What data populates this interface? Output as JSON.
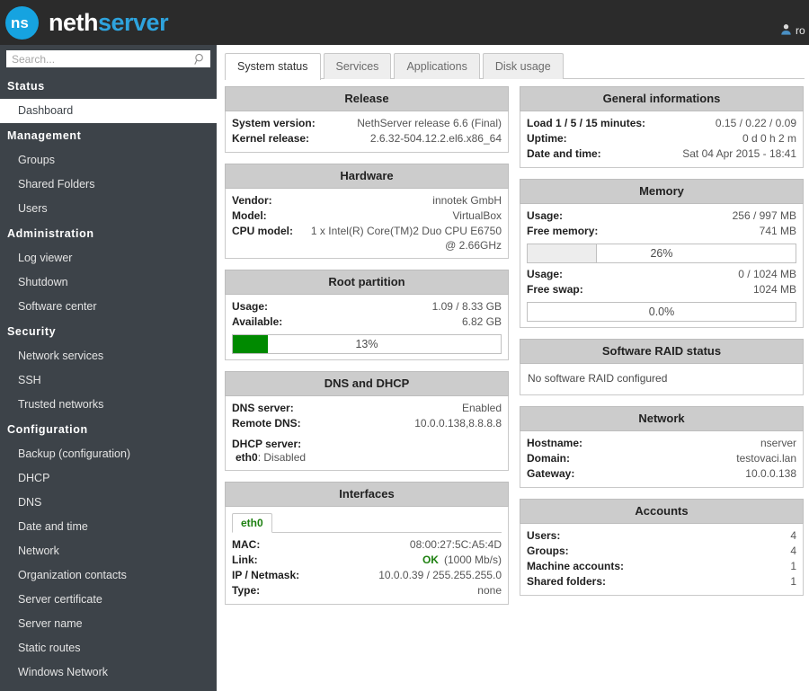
{
  "topbar": {
    "logo_mark": "ns-logo-icon",
    "brand_first": "neth",
    "brand_second": "server",
    "user_icon": "user-icon",
    "user_label": "ro"
  },
  "sidebar": {
    "search": {
      "placeholder": "Search...",
      "value": "",
      "icon": "search-icon"
    },
    "groups": [
      {
        "title": "Status",
        "items": [
          {
            "label": "Dashboard",
            "active": true
          }
        ]
      },
      {
        "title": "Management",
        "items": [
          {
            "label": "Groups",
            "active": false
          },
          {
            "label": "Shared Folders",
            "active": false
          },
          {
            "label": "Users",
            "active": false
          }
        ]
      },
      {
        "title": "Administration",
        "items": [
          {
            "label": "Log viewer",
            "active": false
          },
          {
            "label": "Shutdown",
            "active": false
          },
          {
            "label": "Software center",
            "active": false
          }
        ]
      },
      {
        "title": "Security",
        "items": [
          {
            "label": "Network services",
            "active": false
          },
          {
            "label": "SSH",
            "active": false
          },
          {
            "label": "Trusted networks",
            "active": false
          }
        ]
      },
      {
        "title": "Configuration",
        "items": [
          {
            "label": "Backup (configuration)",
            "active": false
          },
          {
            "label": "DHCP",
            "active": false
          },
          {
            "label": "DNS",
            "active": false
          },
          {
            "label": "Date and time",
            "active": false
          },
          {
            "label": "Network",
            "active": false
          },
          {
            "label": "Organization contacts",
            "active": false
          },
          {
            "label": "Server certificate",
            "active": false
          },
          {
            "label": "Server name",
            "active": false
          },
          {
            "label": "Static routes",
            "active": false
          },
          {
            "label": "Windows Network",
            "active": false
          }
        ]
      }
    ]
  },
  "tabs": [
    {
      "label": "System status",
      "active": true
    },
    {
      "label": "Services",
      "active": false
    },
    {
      "label": "Applications",
      "active": false
    },
    {
      "label": "Disk usage",
      "active": false
    }
  ],
  "left_column": {
    "release": {
      "title": "Release",
      "rows": [
        {
          "key": "System version:",
          "value": "NethServer release 6.6 (Final)"
        },
        {
          "key": "Kernel release:",
          "value": "2.6.32-504.12.2.el6.x86_64"
        }
      ]
    },
    "hardware": {
      "title": "Hardware",
      "rows": [
        {
          "key": "Vendor:",
          "value": "innotek GmbH"
        },
        {
          "key": "Model:",
          "value": "VirtualBox"
        },
        {
          "key": "CPU model:",
          "value": "1 x Intel(R) Core(TM)2 Duo CPU E6750"
        }
      ],
      "cpu_second_line": "@ 2.66GHz"
    },
    "root_partition": {
      "title": "Root partition",
      "rows": [
        {
          "key": "Usage:",
          "value": "1.09 / 8.33 GB"
        },
        {
          "key": "Available:",
          "value": "6.82 GB"
        }
      ],
      "bar": {
        "label": "13%",
        "percent": 13,
        "color": "#008a00"
      }
    },
    "dns_dhcp": {
      "title": "DNS and DHCP",
      "rows": [
        {
          "key": "DNS server:",
          "value": "Enabled"
        },
        {
          "key": "Remote DNS:",
          "value": "10.0.0.138,8.8.8.8"
        }
      ],
      "dhcp_label": "DHCP server:",
      "dhcp_iface": "eth0",
      "dhcp_state": ": Disabled"
    },
    "interfaces": {
      "title": "Interfaces",
      "iface_tabs": [
        {
          "label": "eth0",
          "active": true
        }
      ],
      "rows": [
        {
          "key": "MAC:",
          "value": "08:00:27:5C:A5:4D"
        },
        {
          "key": "IP / Netmask:",
          "value": "10.0.0.39 / 255.255.255.0"
        },
        {
          "key": "Type:",
          "value": "none"
        }
      ],
      "link_key": "Link:",
      "link_status": "OK",
      "link_speed": "(1000 Mb/s)"
    }
  },
  "right_column": {
    "general": {
      "title": "General informations",
      "rows": [
        {
          "key": "Load 1 / 5 / 15 minutes:",
          "value": "0.15 / 0.22 / 0.09"
        },
        {
          "key": "Uptime:",
          "value": "0 d 0 h 2 m"
        },
        {
          "key": "Date and time:",
          "value": "Sat 04 Apr 2015 - 18:41"
        }
      ]
    },
    "memory": {
      "title": "Memory",
      "ram_rows": [
        {
          "key": "Usage:",
          "value": "256 / 997 MB"
        },
        {
          "key": "Free memory:",
          "value": "741 MB"
        }
      ],
      "ram_bar": {
        "label": "26%",
        "percent": 26,
        "color": "#ededed"
      },
      "swap_rows": [
        {
          "key": "Usage:",
          "value": "0 / 1024 MB"
        },
        {
          "key": "Free swap:",
          "value": "1024 MB"
        }
      ],
      "swap_bar": {
        "label": "0.0%",
        "percent": 0,
        "color": "#ededed"
      }
    },
    "raid": {
      "title": "Software RAID status",
      "message": "No software RAID configured"
    },
    "network": {
      "title": "Network",
      "rows": [
        {
          "key": "Hostname:",
          "value": "nserver"
        },
        {
          "key": "Domain:",
          "value": "testovaci.lan"
        },
        {
          "key": "Gateway:",
          "value": "10.0.0.138"
        }
      ]
    },
    "accounts": {
      "title": "Accounts",
      "rows": [
        {
          "key": "Users:",
          "value": "4"
        },
        {
          "key": "Groups:",
          "value": "4"
        },
        {
          "key": "Machine accounts:",
          "value": "1"
        },
        {
          "key": "Shared folders:",
          "value": "1"
        }
      ]
    }
  }
}
